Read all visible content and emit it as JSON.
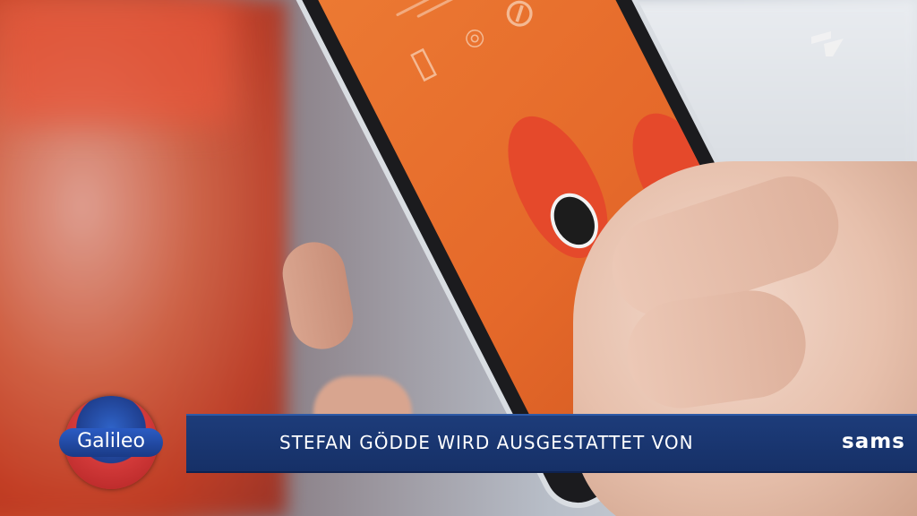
{
  "channel": {
    "logo": "pro7-logo"
  },
  "show": {
    "logo_text": "Galileo"
  },
  "lower_third": {
    "headline": "STEFAN GÖDDE WIRD AUSGESTATTET VON",
    "brand_partial": "sams"
  },
  "colors": {
    "lower_third_bg": "#1d3c7a",
    "screen_orange": "#ec7a33",
    "shoe_red": "#e5492b"
  }
}
